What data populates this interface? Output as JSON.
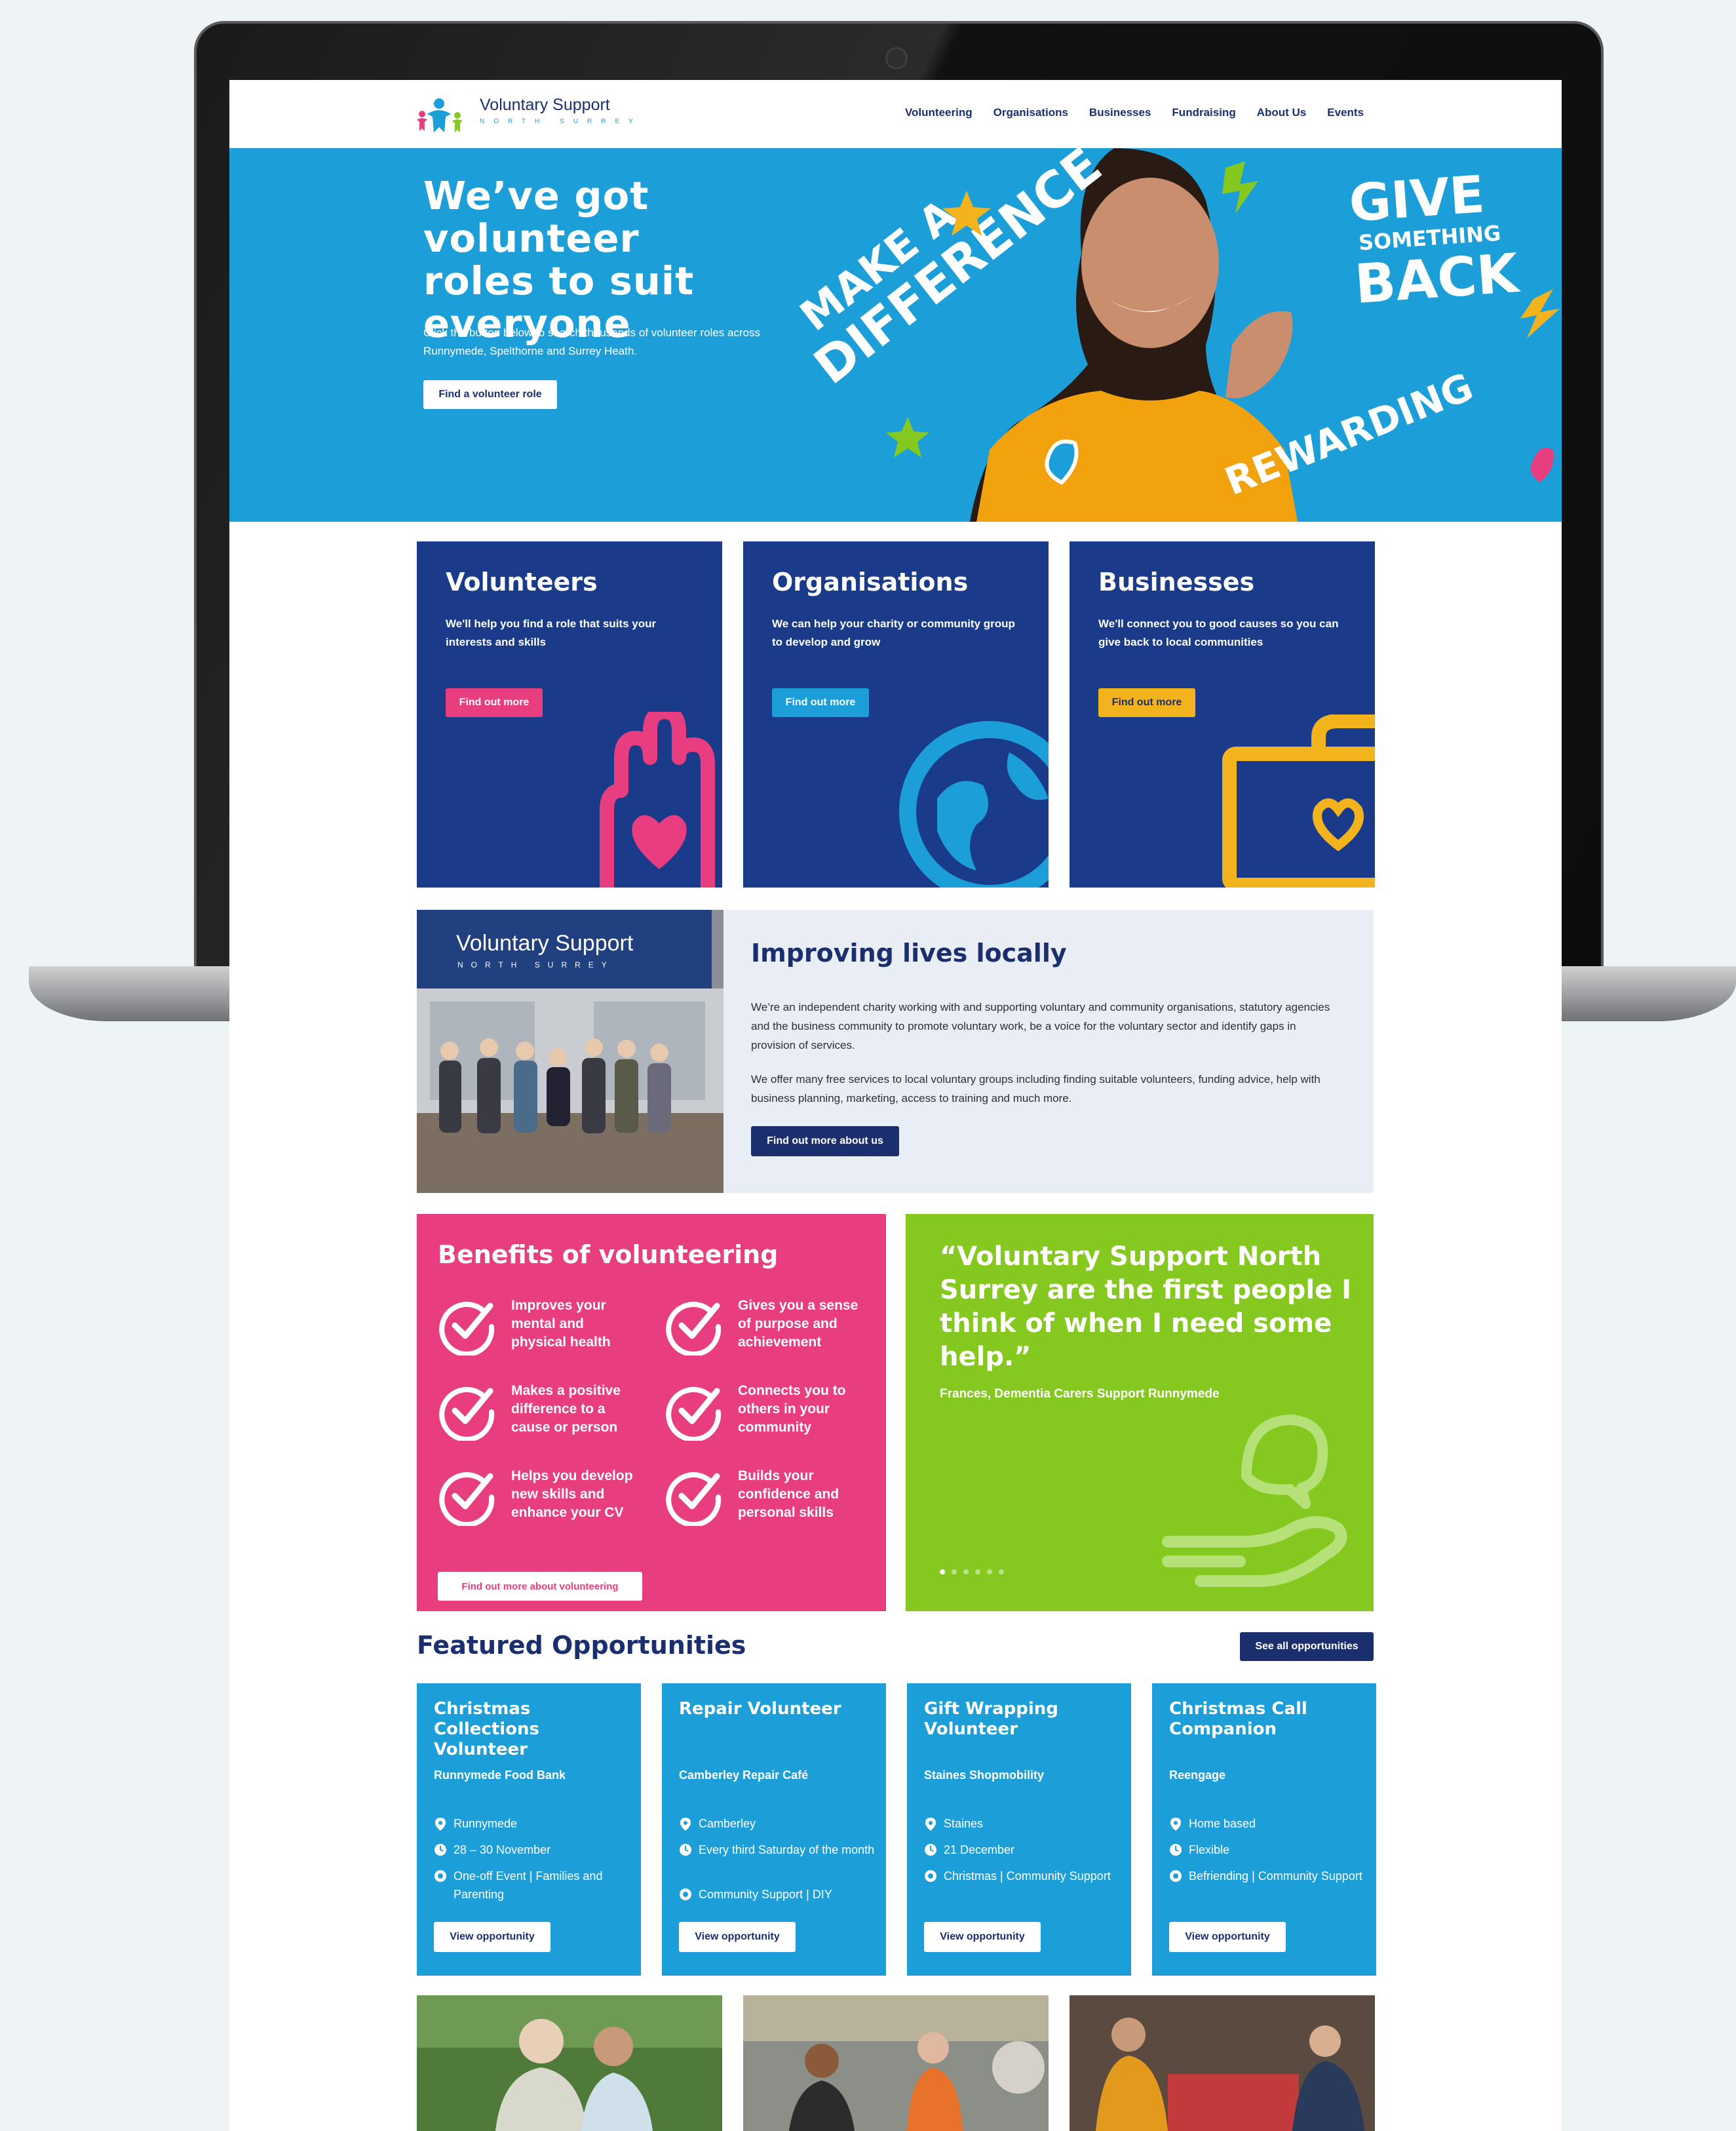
{
  "site": {
    "logo_name": "Voluntary Support",
    "logo_sub": "NORTH SURREY"
  },
  "nav": {
    "items": [
      "Volunteering",
      "Organisations",
      "Businesses",
      "Fundraising",
      "About Us",
      "Events"
    ]
  },
  "hero": {
    "heading": "We’ve got volunteer roles to suit everyone",
    "text": "Click the button below to search thousands of volunteer roles across Runnymede, Spelthorne and Surrey Heath.",
    "button": "Find a volunteer role",
    "art_words": [
      "MAKE A",
      "DIFFERENCE",
      "GIVE",
      "SOMETHING",
      "BACK",
      "REWARDING"
    ]
  },
  "cards": [
    {
      "title": "Volunteers",
      "text": "We'll help you find a role that suits your interests and skills",
      "button": "Find out more",
      "accent": "#e83e80",
      "icon": "hand-heart-icon"
    },
    {
      "title": "Organisations",
      "text": "We can help your charity or community group to develop and grow",
      "button": "Find out more",
      "accent": "#1c9fd9",
      "icon": "globe-icon"
    },
    {
      "title": "Businesses",
      "text": "We'll connect you to good causes so you can give back to local communities",
      "button": "Find out more",
      "accent": "#f3b31d",
      "icon": "briefcase-heart-icon"
    }
  ],
  "about": {
    "photo_sign": "Voluntary Support",
    "photo_sign_sub": "NORTH SURREY",
    "heading": "Improving lives locally",
    "para1": "We’re an independent charity working with and supporting voluntary and community organisations, statutory agencies and the business community to promote voluntary work, be a voice for the voluntary sector and identify gaps in provision of services.",
    "para2": "We offer many free services to local voluntary groups including finding suitable volunteers, funding advice, help with business planning, marketing, access to training and much more.",
    "button": "Find out more about us"
  },
  "benefits": {
    "heading": "Benefits of volunteering",
    "items": [
      "Improves your mental and physical health",
      "Gives you a sense of purpose and achievement",
      "Makes a positive difference to a cause or person",
      "Connects you to others in your community",
      "Helps you develop new skills and enhance your CV",
      "Builds your confidence and personal skills"
    ],
    "button": "Find out more about volunteering"
  },
  "quote": {
    "text": "“Voluntary Support North Surrey are the first people I think of when I need some help.”",
    "cite": "Frances, Dementia Carers Support Runnymede",
    "slides": 6,
    "active_slide": 1
  },
  "featured": {
    "heading": "Featured Opportunities",
    "see_all": "See all opportunities",
    "items": [
      {
        "title": "Christmas Collections Volunteer",
        "org": "Runnymede Food Bank",
        "location": "Runnymede",
        "date": "28 – 30 November",
        "category": "One-off Event | Families and Parenting",
        "button": "View opportunity"
      },
      {
        "title": "Repair Volunteer",
        "org": "Camberley Repair Café",
        "location": "Camberley",
        "date": "Every third Saturday of the month",
        "category": "Community Support | DIY",
        "button": "View opportunity"
      },
      {
        "title": "Gift Wrapping Volunteer",
        "org": "Staines Shopmobility",
        "location": "Staines",
        "date": "21 December",
        "category": "Christmas | Community Support",
        "button": "View opportunity"
      },
      {
        "title": "Christmas Call Companion",
        "org": "Reengage",
        "location": "Home based",
        "date": "Flexible",
        "category": "Befriending | Community Support",
        "button": "View opportunity"
      }
    ]
  },
  "colors": {
    "navy": "#1b2f6e",
    "card_navy": "#1a3a8a",
    "blue": "#1c9fd9",
    "pink": "#e83e80",
    "green": "#85c820",
    "yellow": "#f3b31d"
  }
}
